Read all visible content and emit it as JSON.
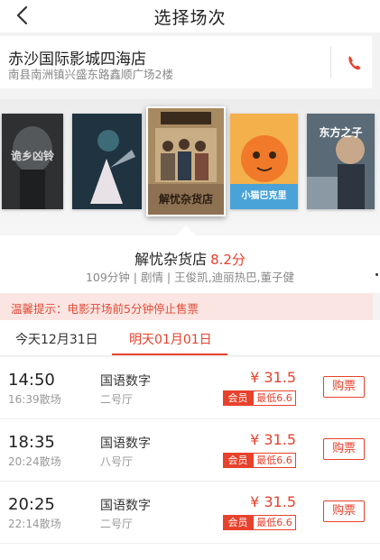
{
  "header": {
    "title": "选择场次"
  },
  "cinema": {
    "name": "赤沙国际影城四海店",
    "address": "南县南洲镇兴盛东路鑫顺广场2楼"
  },
  "posters": [
    {
      "title": "诡乡凶铃",
      "bg": "#3b3d3f"
    },
    {
      "title": "",
      "bg": "#243944"
    },
    {
      "title": "解忧杂货店",
      "bg": "#b79a70"
    },
    {
      "title": "小猫巴克里",
      "bg": "#f1a33a"
    },
    {
      "title": "东方之子",
      "bg": "#6a7b88"
    }
  ],
  "movie": {
    "title": "解忧杂货店",
    "score": "8.2分",
    "meta": "109分钟 | 剧情 | 王俊凯,迪丽热巴,董子健"
  },
  "notice": "温馨提示：电影开场前5分钟停止售票",
  "tabs": {
    "today": "今天12月31日",
    "tomorrow": "明天01月01日"
  },
  "showings": [
    {
      "time": "14:50",
      "end": "16:39散场",
      "lang": "国语数字",
      "hall": "二号厅",
      "price": "¥ 31.5",
      "member": "会员",
      "low": "最低6.6",
      "buy": "购票"
    },
    {
      "time": "18:35",
      "end": "20:24散场",
      "lang": "国语数字",
      "hall": "八号厅",
      "price": "¥ 31.5",
      "member": "会员",
      "low": "最低6.6",
      "buy": "购票"
    },
    {
      "time": "20:25",
      "end": "22:14散场",
      "lang": "国语数字",
      "hall": "二号厅",
      "price": "¥ 31.5",
      "member": "会员",
      "low": "最低6.6",
      "buy": "购票"
    }
  ],
  "colors": {
    "accent": "#e8412c",
    "notice_bg": "#fbe5e2"
  }
}
